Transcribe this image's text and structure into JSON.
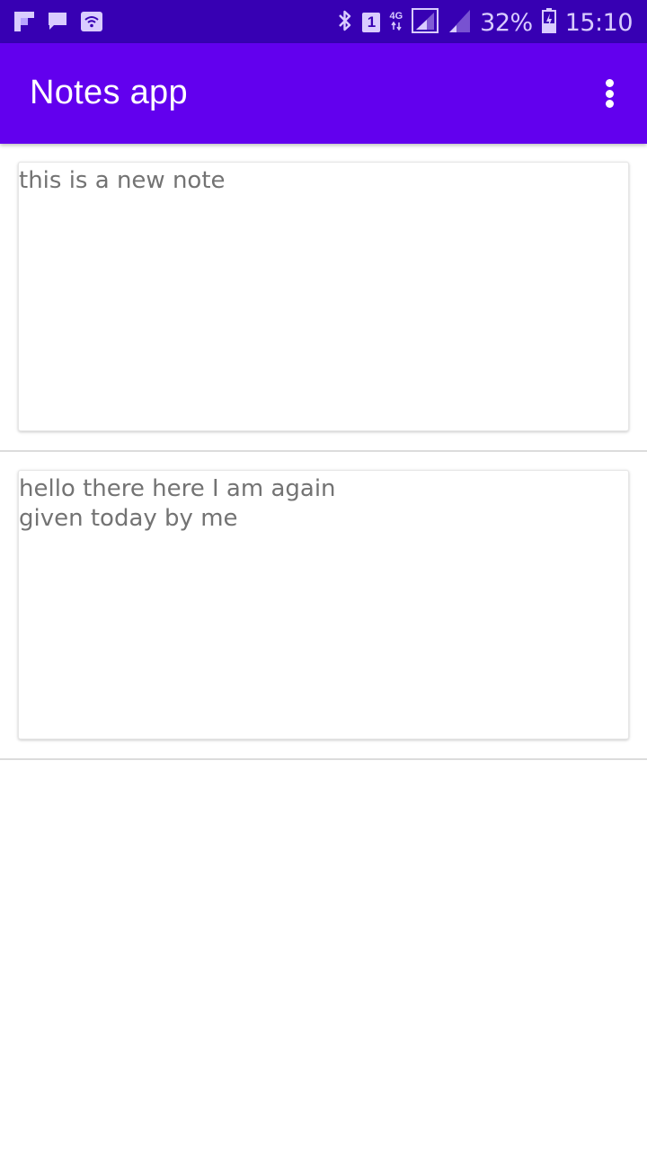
{
  "status_bar": {
    "left_icons": [
      "flipboard-icon",
      "chat-icon",
      "wifi-call-icon"
    ],
    "bluetooth_icon": "bluetooth-icon",
    "sim_badge": "1",
    "network_type": "4G",
    "battery_percent": "32%",
    "time": "15:10"
  },
  "app_bar": {
    "title": "Notes app",
    "menu_icon": "more-vert-icon",
    "color": "#6200ee",
    "status_color": "#3700b3"
  },
  "notes": [
    {
      "text": "this is a new note"
    },
    {
      "text": "hello there here I am again\ngiven today by me"
    }
  ]
}
